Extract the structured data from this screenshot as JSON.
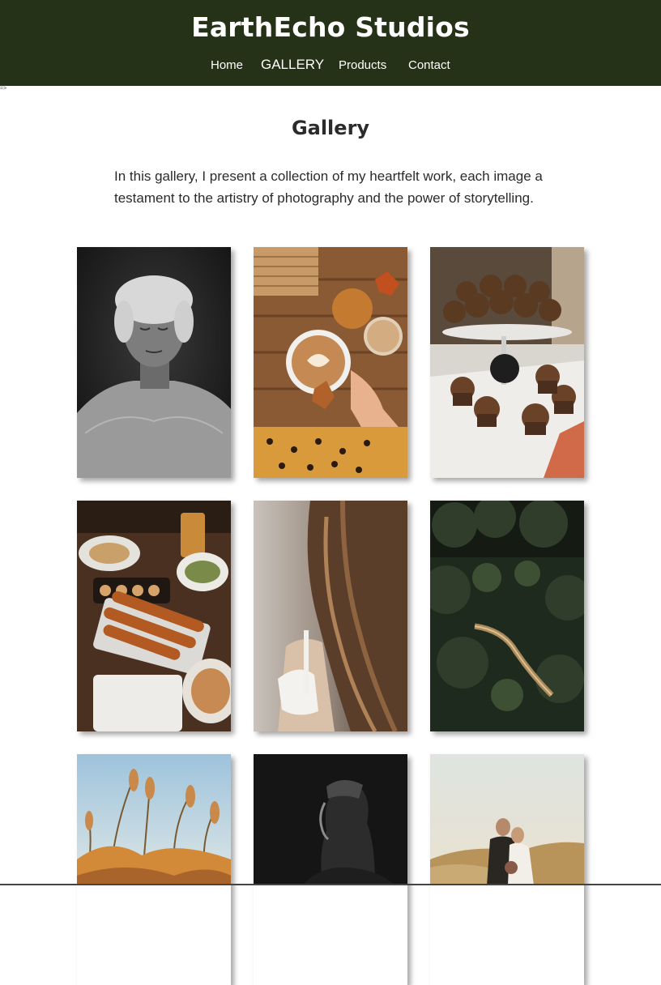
{
  "header": {
    "brand": "EarthEcho Studios",
    "nav": [
      {
        "label": "Home"
      },
      {
        "label": "GALLERY"
      },
      {
        "label": "Products"
      },
      {
        "label": "Contact"
      }
    ]
  },
  "stray_text": "=>",
  "main": {
    "title": "Gallery",
    "intro": "In this gallery, I present a collection of my heartfelt work, each image a testament to the artistry of photography and the power of storytelling."
  },
  "gallery": {
    "photos": [
      {
        "subject": "elderly-woman-portrait"
      },
      {
        "subject": "latte-pumpkins"
      },
      {
        "subject": "chocolate-cupcakes"
      },
      {
        "subject": "food-platter-pretzels"
      },
      {
        "subject": "woman-hair-closeup"
      },
      {
        "subject": "forest-road-aerial"
      },
      {
        "subject": "dry-grass-sky"
      },
      {
        "subject": "man-profile-dark"
      },
      {
        "subject": "wedding-couple-beach"
      }
    ]
  }
}
